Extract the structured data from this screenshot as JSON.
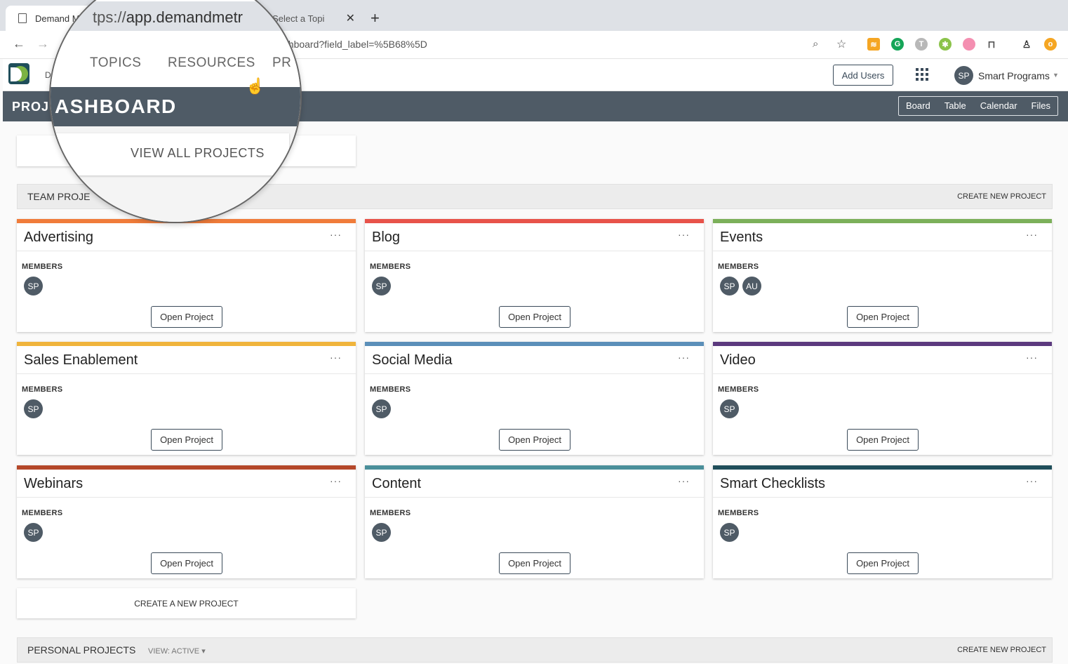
{
  "browser": {
    "tabs": [
      {
        "title": "Demand Me"
      },
      {
        "title": "inder: Select a Topi"
      }
    ],
    "url": "ashboard?field_label=%5B68%5D"
  },
  "app": {
    "breadcrumb": "D",
    "add_users_label": "Add Users",
    "user_initials": "SP",
    "user_name": "Smart Programs",
    "page_title": "PROJ",
    "view_tabs": [
      "Board",
      "Table",
      "Calendar",
      "Files"
    ]
  },
  "magnifier": {
    "url_prefix": "tps://",
    "url_host": "app.demandmetr",
    "nav": [
      "TOPICS",
      "RESOURCES",
      "PR"
    ],
    "title": "ASHBOARD",
    "view_all": "VIEW ALL PROJECTS"
  },
  "team_section": {
    "label": "TEAM PROJE",
    "create_label": "CREATE NEW PROJECT"
  },
  "members_label": "MEMBERS",
  "open_label": "Open Project",
  "projects": [
    {
      "title": "Advertising",
      "color": "#f07c3a",
      "members": [
        "SP"
      ]
    },
    {
      "title": "Blog",
      "color": "#e8534a",
      "members": [
        "SP"
      ]
    },
    {
      "title": "Events",
      "color": "#7cb05a",
      "members": [
        "SP",
        "AU"
      ]
    },
    {
      "title": "Sales Enablement",
      "color": "#f0b43c",
      "members": [
        "SP"
      ]
    },
    {
      "title": "Social Media",
      "color": "#5b8fb9",
      "members": [
        "SP"
      ]
    },
    {
      "title": "Video",
      "color": "#5c3a7e",
      "members": [
        "SP"
      ]
    },
    {
      "title": "Webinars",
      "color": "#b5482a",
      "members": [
        "SP"
      ]
    },
    {
      "title": "Content",
      "color": "#4a8f9a",
      "members": [
        "SP"
      ]
    },
    {
      "title": "Smart Checklists",
      "color": "#1f4e5a",
      "members": [
        "SP"
      ]
    }
  ],
  "more_label": "···",
  "create_card_label": "CREATE A NEW PROJECT",
  "personal_section": {
    "label": "PERSONAL PROJECTS",
    "view_label": "VIEW: ACTIVE ▾",
    "create_label": "CREATE NEW PROJECT"
  }
}
